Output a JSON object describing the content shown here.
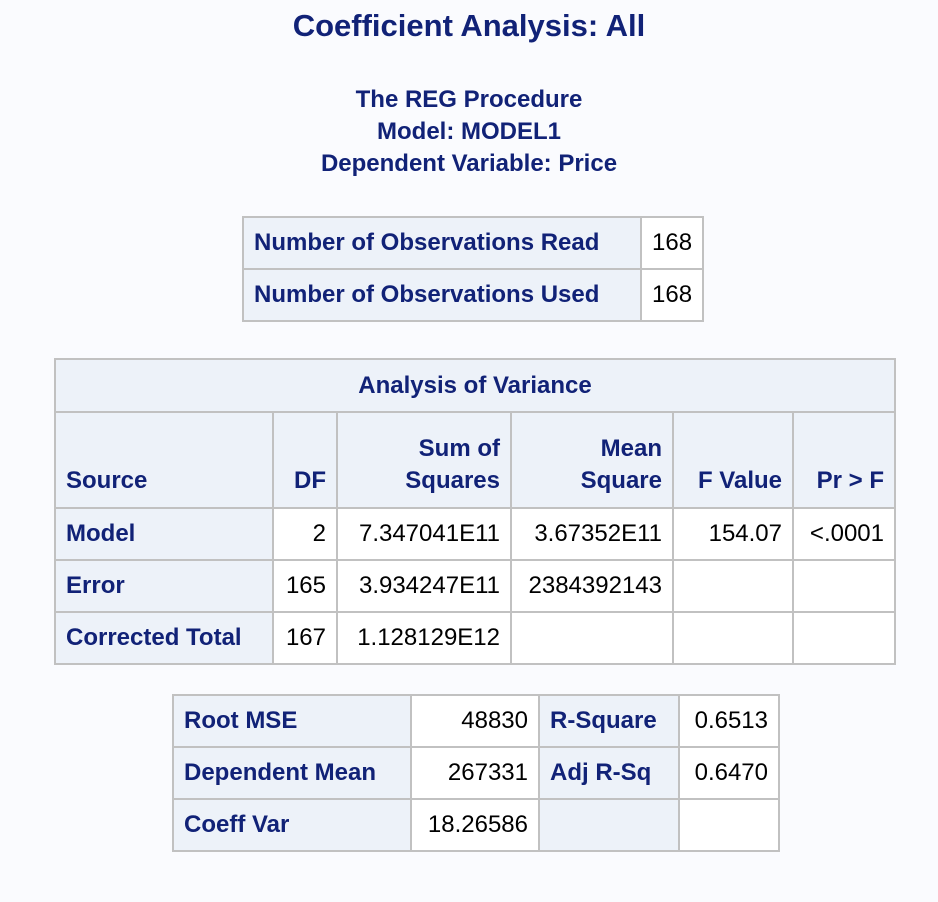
{
  "title": "Coefficient Analysis: All",
  "subtitles": {
    "procedure": "The REG Procedure",
    "model": "Model: MODEL1",
    "dependent": "Dependent Variable: Price"
  },
  "observations": {
    "rows": [
      {
        "label": "Number of Observations Read",
        "value": "168"
      },
      {
        "label": "Number of Observations Used",
        "value": "168"
      }
    ]
  },
  "anova": {
    "caption": "Analysis of Variance",
    "headers": {
      "source": "Source",
      "df": "DF",
      "ss_line1": "Sum of",
      "ss_line2": "Squares",
      "ms_line1": "Mean",
      "ms_line2": "Square",
      "fvalue": "F Value",
      "prf": "Pr > F"
    },
    "rows": [
      {
        "source": "Model",
        "df": "2",
        "ss": "7.347041E11",
        "ms": "3.67352E11",
        "f": "154.07",
        "p": "<.0001"
      },
      {
        "source": "Error",
        "df": "165",
        "ss": "3.934247E11",
        "ms": "2384392143",
        "f": "",
        "p": ""
      },
      {
        "source": "Corrected Total",
        "df": "167",
        "ss": "1.128129E12",
        "ms": "",
        "f": "",
        "p": ""
      }
    ]
  },
  "fit": {
    "rows": [
      {
        "label1": "Root MSE",
        "value1": "48830",
        "label2": "R-Square",
        "value2": "0.6513"
      },
      {
        "label1": "Dependent Mean",
        "value1": "267331",
        "label2": "Adj R-Sq",
        "value2": "0.6470"
      },
      {
        "label1": "Coeff Var",
        "value1": "18.26586",
        "label2": "",
        "value2": ""
      }
    ]
  },
  "colors": {
    "header_text": "#112277",
    "header_bg": "#edf2f9",
    "border": "#c1c1c1",
    "page_bg": "#fafbfe"
  }
}
